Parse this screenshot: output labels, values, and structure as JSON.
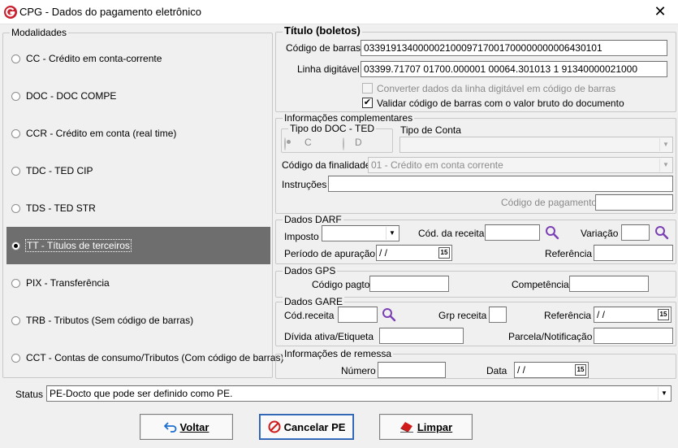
{
  "window": {
    "title": "CPG - Dados do pagamento eletrônico",
    "close_glyph": "✕"
  },
  "modalidades": {
    "title": "Modalidades",
    "items": [
      {
        "label": "CC  - Crédito em conta-corrente",
        "selected": false
      },
      {
        "label": "DOC - DOC COMPE",
        "selected": false
      },
      {
        "label": "CCR - Crédito em conta (real time)",
        "selected": false
      },
      {
        "label": "TDC - TED CIP",
        "selected": false
      },
      {
        "label": "TDS - TED STR",
        "selected": false
      },
      {
        "label": "TT  - Títulos de terceiros",
        "selected": true
      },
      {
        "label": "PIX - Transferência",
        "selected": false
      },
      {
        "label": "TRB - Tributos (Sem código de barras)",
        "selected": false
      },
      {
        "label": "CCT - Contas de consumo/Tributos (Com código de barras)",
        "selected": false
      }
    ]
  },
  "titulo": {
    "title": "Título (boletos)",
    "codigo_barras_label": "Código de barras",
    "codigo_barras_value": "03391913400000210009717001700000000006430101",
    "linha_digitavel_label": "Linha digitável",
    "linha_digitavel_value": "03399.71707 01700.000001 00064.301013 1 91340000021000",
    "converter_label": "Converter dados da linha digitável em código de barras",
    "converter_checked": false,
    "validar_label": "Validar código de barras com o valor bruto do documento",
    "validar_checked": true,
    "check_glyph": "✔"
  },
  "info_compl": {
    "title": "Informações complementares",
    "tipo_doc_ted_title": "Tipo do DOC - TED",
    "opt_c": "C",
    "opt_d": "D",
    "tipo_conta_label": "Tipo de Conta",
    "tipo_conta_value": "",
    "codigo_finalidade_label": "Código da finalidade",
    "codigo_finalidade_value": "01 - Crédito em conta corrente",
    "instrucoes_label": "Instruções",
    "instrucoes_value": "",
    "codigo_pagamento_label": "Código de pagamento",
    "codigo_pagamento_value": ""
  },
  "darf": {
    "title": "Dados DARF",
    "imposto_label": "Imposto",
    "imposto_value": "",
    "cod_receita_label": "Cód. da receita",
    "cod_receita_value": "",
    "variacao_label": "Variação",
    "variacao_value": "",
    "periodo_label": "Período de apuração",
    "periodo_value": " / /",
    "referencia_label": "Referência",
    "referencia_value": ""
  },
  "gps": {
    "title": "Dados GPS",
    "codigo_pagto_label": "Código pagto",
    "codigo_pagto_value": "",
    "competencia_label": "Competência",
    "competencia_value": ""
  },
  "gare": {
    "title": "Dados GARE",
    "cod_receita_label": "Cód.receita",
    "cod_receita_value": "",
    "grp_receita_label": "Grp receita",
    "grp_receita_value": "",
    "referencia_label": "Referência",
    "referencia_value": " / /",
    "divida_label": "Dívida ativa/Etiqueta",
    "divida_value": "",
    "parcela_label": "Parcela/Notificação",
    "parcela_value": ""
  },
  "remessa": {
    "title": "Informações de remessa",
    "numero_label": "Número",
    "numero_value": "",
    "data_label": "Data",
    "data_value": " / /"
  },
  "calendar_glyph": "15",
  "status": {
    "label": "Status",
    "value": "PE-Docto  que pode ser definido como PE."
  },
  "buttons": {
    "voltar": "Voltar",
    "cancelar": "Cancelar PE",
    "limpar": "Limpar"
  },
  "colors": {
    "selected_row": "#6e6e6e",
    "search_icon": "#7b3fb5",
    "cancel_icon": "#d11a1a",
    "back_icon": "#1c6fd0",
    "logo": "#c8202f"
  }
}
